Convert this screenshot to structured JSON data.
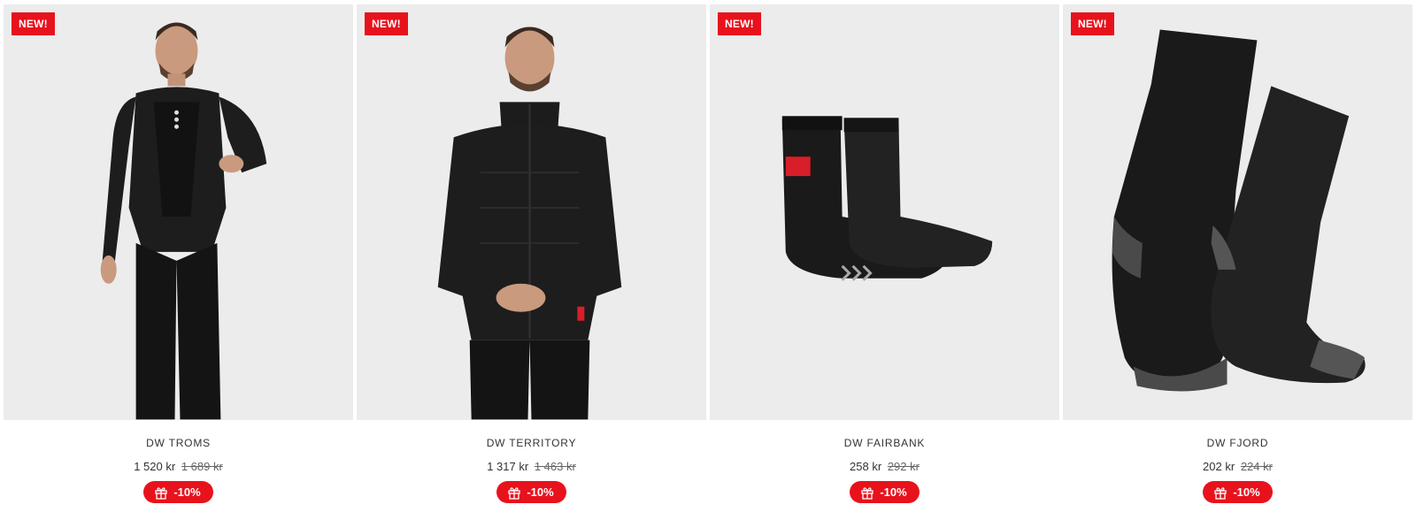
{
  "products": [
    {
      "badge": "NEW!",
      "title": "DW TROMS",
      "price": "1 520 kr",
      "old_price": "1 689 kr",
      "discount": "-10%",
      "image": "bib-tights-person"
    },
    {
      "badge": "NEW!",
      "title": "DW TERRITORY",
      "price": "1 317 kr",
      "old_price": "1 463 kr",
      "discount": "-10%",
      "image": "jacket-person"
    },
    {
      "badge": "NEW!",
      "title": "DW FAIRBANK",
      "price": "258 kr",
      "old_price": "292 kr",
      "discount": "-10%",
      "image": "shoe-covers"
    },
    {
      "badge": "NEW!",
      "title": "DW FJORD",
      "price": "202 kr",
      "old_price": "224 kr",
      "discount": "-10%",
      "image": "socks"
    }
  ],
  "colors": {
    "accent": "#e8121c",
    "image_bg": "#ececec",
    "product": "#1a1a1a"
  },
  "icons": {
    "discount": "gift-icon"
  }
}
